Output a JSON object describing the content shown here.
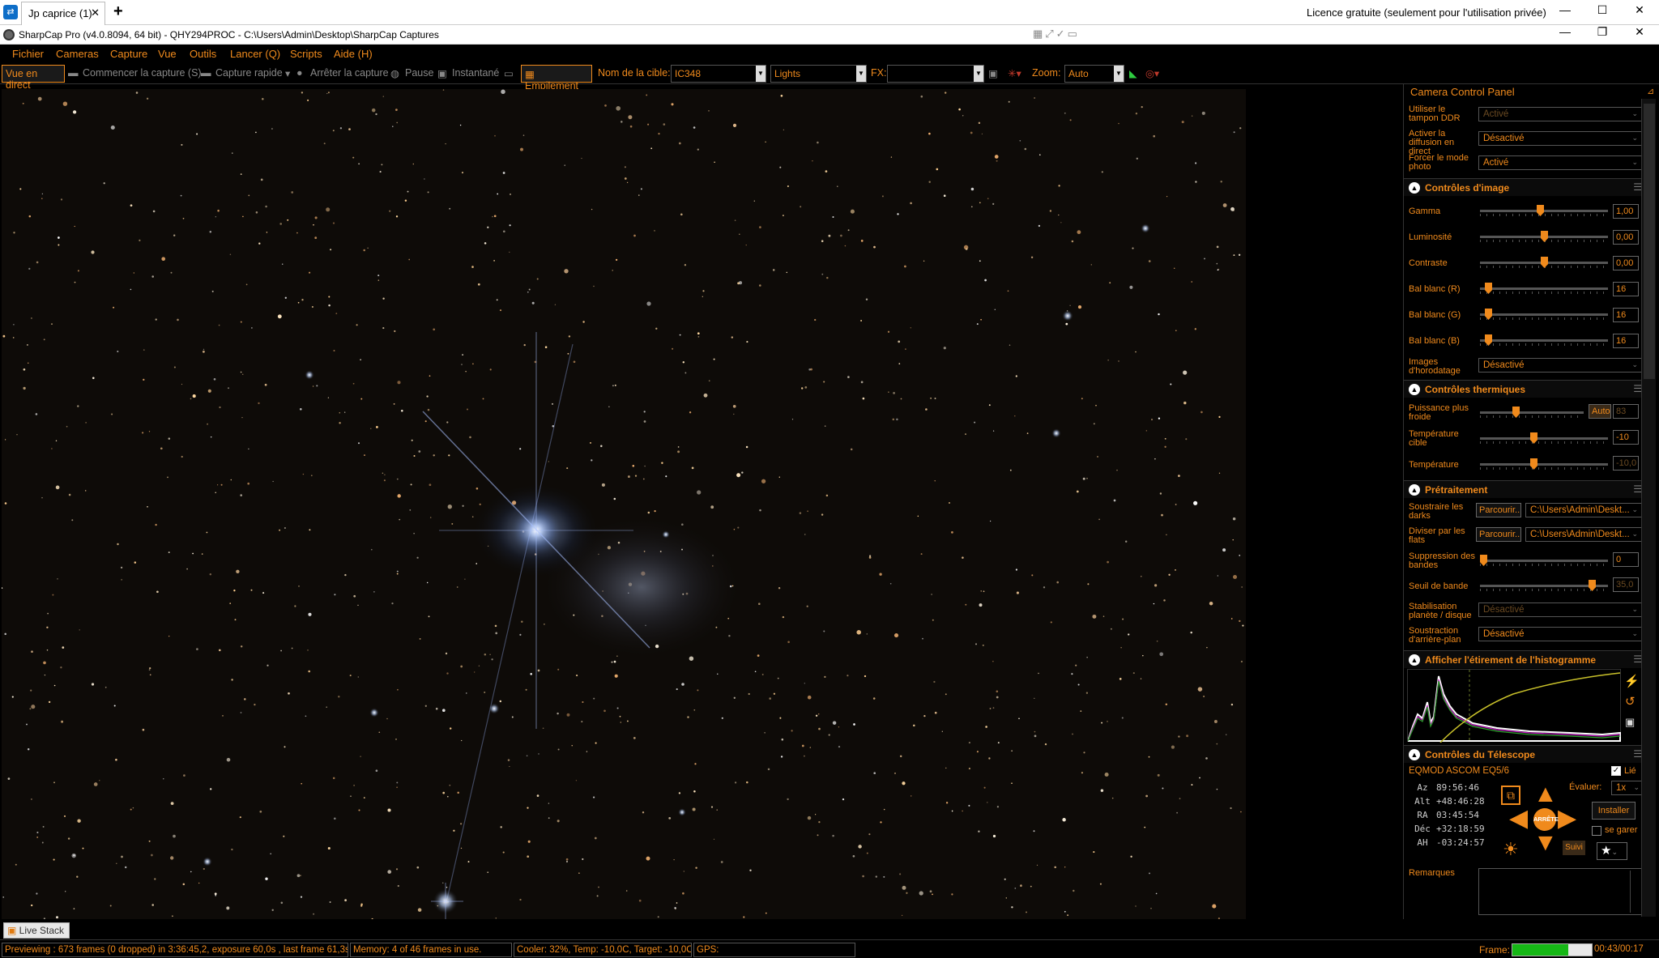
{
  "browser": {
    "tab_label": "Jp caprice (1)",
    "tab_close": "✕",
    "new_tab": "+",
    "licence": "Licence gratuite (seulement pour l'utilisation privée)"
  },
  "window": {
    "title": "SharpCap Pro (v4.0.8094, 64 bit) - QHY294PROC - C:\\Users\\Admin\\Desktop\\SharpCap Captures"
  },
  "menu": [
    "Fichier",
    "Cameras",
    "Capture",
    "Vue",
    "Outils",
    "Lancer (Q)",
    "Scripts",
    "Aide (H)"
  ],
  "toolbar": {
    "live": "Vue en direct",
    "start_capture": "Commencer la capture (S)",
    "quick_capture": "Capture rapide",
    "stop_capture": "Arrêter la capture",
    "pause": "Pause",
    "snapshot": "Instantané",
    "stacking": "Empilement",
    "target_label": "Nom de la cible:",
    "target_value": "IC348",
    "frame_type": "Lights",
    "fx_label": "FX:",
    "fx_value": "",
    "zoom_label": "Zoom:",
    "zoom_value": "Auto"
  },
  "panel": {
    "title": "Camera Control Panel",
    "top_rows": [
      {
        "label": "Utiliser le tampon DDR",
        "value": "Activé",
        "dim": true
      },
      {
        "label": "Activer la diffusion en direct",
        "value": "Désactivé",
        "dim": false
      },
      {
        "label": "Forcer le mode photo",
        "value": "Activé",
        "dim": false
      }
    ],
    "image_controls": {
      "title": "Contrôles d'image",
      "gamma": {
        "label": "Gamma",
        "value": "1,00"
      },
      "brightness": {
        "label": "Luminosité",
        "value": "0,00"
      },
      "contrast": {
        "label": "Contraste",
        "value": "0,00"
      },
      "wb_r": {
        "label": "Bal blanc (R)",
        "value": "16"
      },
      "wb_g": {
        "label": "Bal blanc (G)",
        "value": "16"
      },
      "wb_b": {
        "label": "Bal blanc (B)",
        "value": "16"
      },
      "timestamp": {
        "label": "Images d'horodatage",
        "value": "Désactivé"
      }
    },
    "thermal": {
      "title": "Contrôles thermiques",
      "cooler_power": {
        "label": "Puissance plus froide",
        "auto": "Auto",
        "value": "83"
      },
      "target_temp": {
        "label": "Température cible",
        "value": "-10"
      },
      "temperature": {
        "label": "Température",
        "value": "-10,0"
      }
    },
    "preprocessing": {
      "title": "Prétraitement",
      "darks": {
        "label": "Soustraire les darks",
        "browse": "Parcourir...",
        "path": "C:\\Users\\Admin\\Deskt..."
      },
      "flats": {
        "label": "Diviser par les flats",
        "browse": "Parcourir...",
        "path": "C:\\Users\\Admin\\Deskt..."
      },
      "banding": {
        "label": "Suppression des bandes",
        "value": "0"
      },
      "band_threshold": {
        "label": "Seuil de bande",
        "value": "35,0"
      },
      "planet_stab": {
        "label": "Stabilisation planète / disque",
        "value": "Désactivé"
      },
      "bg_subtract": {
        "label": "Soustraction d'arrière-plan",
        "value": "Désactivé"
      }
    },
    "histogram": {
      "title": "Afficher l'étirement de l'histogramme"
    },
    "telescope": {
      "title": "Contrôles du Télescope",
      "mount": "EQMOD ASCOM EQ5/6",
      "linked": "Lié",
      "coords": [
        {
          "k": "Az",
          "v": "89:56:46"
        },
        {
          "k": "Alt",
          "v": "+48:46:28"
        },
        {
          "k": "RA",
          "v": "03:45:54"
        },
        {
          "k": "Déc",
          "v": "+32:18:59"
        },
        {
          "k": "AH",
          "v": "-03:24:57"
        }
      ],
      "rate_label": "Évaluer:",
      "rate_value": "1x",
      "install": "Installer",
      "park": "se garer",
      "stop": "ARRÊTE",
      "track": "Suivi"
    },
    "notes_label": "Remarques"
  },
  "bottom_tab": "Live Stack",
  "status": {
    "preview": "Previewing : 673 frames (0 dropped) in 3:36:45,2, exposure 60,0s , last frame 61,3s",
    "memory": "Memory: 4 of 46 frames in use.",
    "cooler": "Cooler: 32%, Temp: -10,0C, Target: -10,0C",
    "gps": "GPS:",
    "frame_label": "Frame:",
    "frame_progress": 0.7,
    "timer": "00:43/00:17"
  },
  "colors": {
    "accent": "#f08a1c",
    "background": "#000000"
  }
}
